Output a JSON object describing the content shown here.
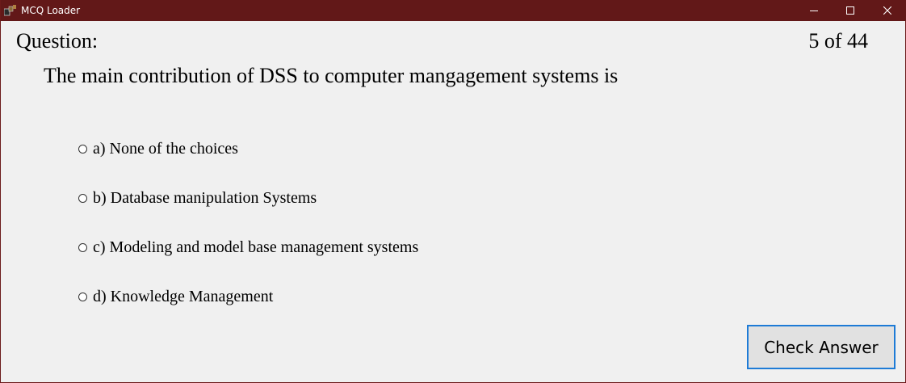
{
  "window": {
    "title": "MCQ Loader",
    "titlebar_color": "#621818",
    "icons": {
      "app": "app-icon",
      "minimize": "minimize-icon",
      "maximize": "maximize-icon",
      "close": "close-icon"
    }
  },
  "question": {
    "label": "Question:",
    "counter": "5 of 44",
    "text": "The main contribution of DSS to computer mangagement systems is"
  },
  "options": [
    {
      "label": "a) None of the choices",
      "selected": false
    },
    {
      "label": "b) Database manipulation Systems",
      "selected": false
    },
    {
      "label": "c) Modeling and model base management systems",
      "selected": false
    },
    {
      "label": "d) Knowledge Management",
      "selected": false
    }
  ],
  "actions": {
    "check_label": "Check Answer",
    "accent_color": "#1e7bd6"
  }
}
